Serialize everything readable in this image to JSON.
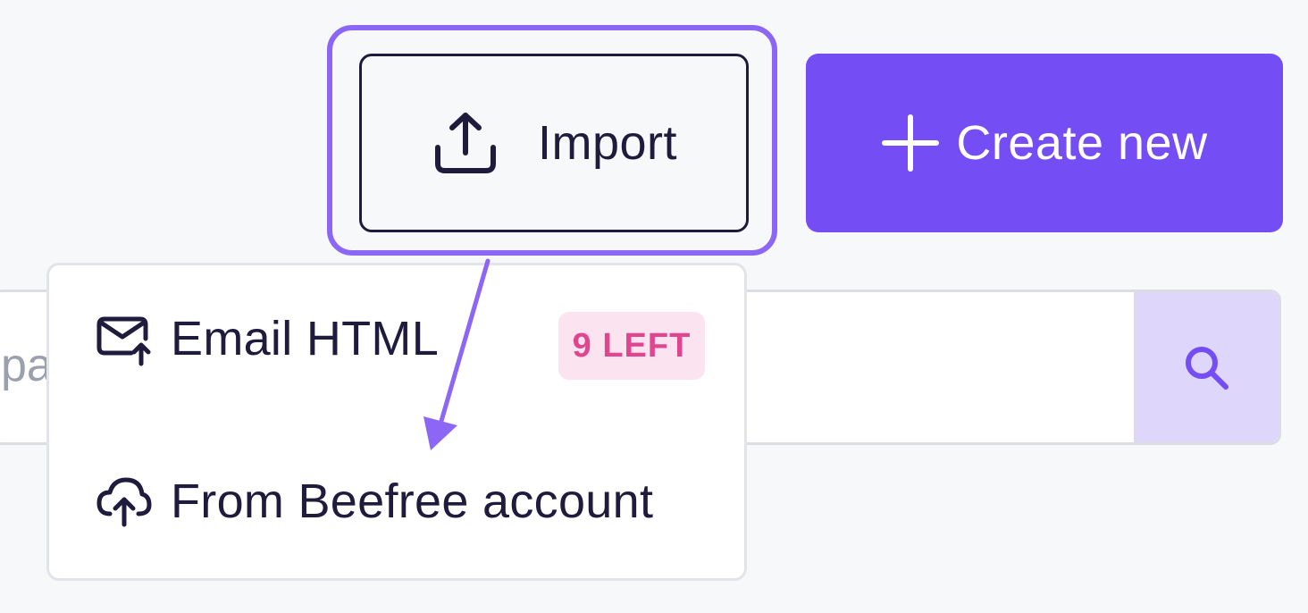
{
  "toolbar": {
    "import_label": "Import",
    "create_label": "Create new"
  },
  "search": {
    "placeholder_fragment": "pa"
  },
  "import_menu": {
    "items": [
      {
        "label": "Email HTML",
        "badge": "9 LEFT",
        "icon": "mail-upload-icon"
      },
      {
        "label": "From Beefree account",
        "icon": "cloud-upload-icon"
      }
    ]
  },
  "colors": {
    "accent": "#744df5",
    "highlight": "#8c66f5",
    "text": "#1f1b3d",
    "badge_bg": "#fbe3ef",
    "badge_text": "#e0458f",
    "search_button_bg": "#ded6fb"
  }
}
